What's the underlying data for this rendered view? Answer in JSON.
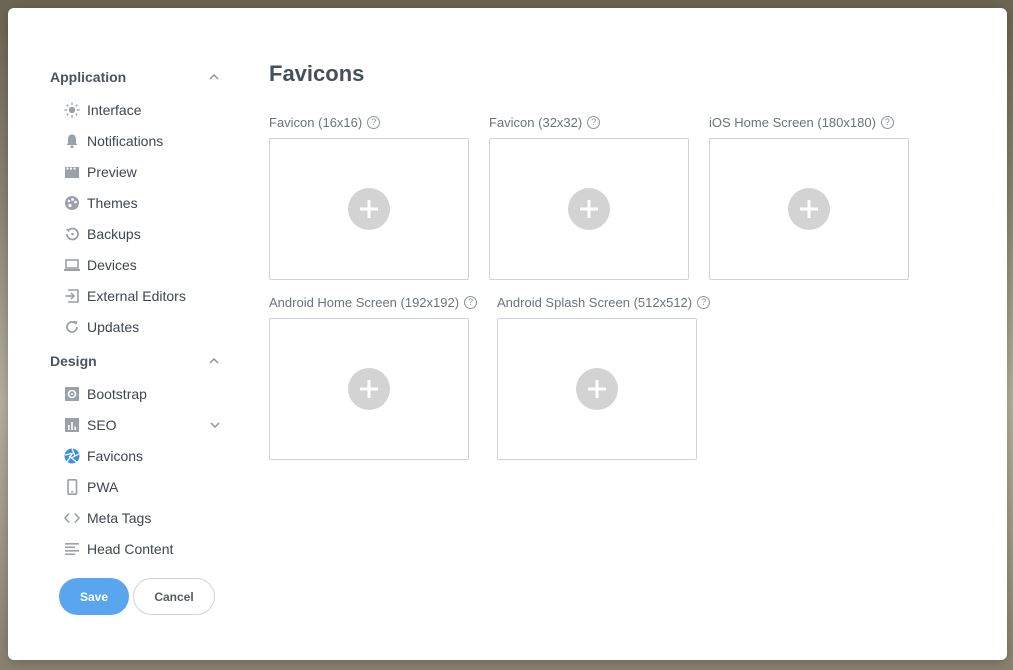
{
  "sidebar": {
    "application": {
      "title": "Application",
      "items": [
        {
          "label": "Interface",
          "icon": "sun-icon"
        },
        {
          "label": "Notifications",
          "icon": "bell-icon"
        },
        {
          "label": "Preview",
          "icon": "clapper-icon"
        },
        {
          "label": "Themes",
          "icon": "palette-icon"
        },
        {
          "label": "Backups",
          "icon": "restore-icon"
        },
        {
          "label": "Devices",
          "icon": "laptop-icon"
        },
        {
          "label": "External Editors",
          "icon": "sign-in-icon"
        },
        {
          "label": "Updates",
          "icon": "refresh-icon"
        }
      ]
    },
    "design": {
      "title": "Design",
      "items": [
        {
          "label": "Bootstrap",
          "icon": "gear-box-icon"
        },
        {
          "label": "SEO",
          "icon": "chart-icon"
        },
        {
          "label": "Favicons",
          "icon": "aperture-icon",
          "active": true
        },
        {
          "label": "PWA",
          "icon": "phone-icon"
        },
        {
          "label": "Meta Tags",
          "icon": "code-icon"
        },
        {
          "label": "Head Content",
          "icon": "align-left-icon"
        }
      ]
    }
  },
  "buttons": {
    "save": "Save",
    "cancel": "Cancel"
  },
  "main": {
    "title": "Favicons",
    "fields": [
      {
        "label": "Favicon (16x16)"
      },
      {
        "label": "Favicon (32x32)"
      },
      {
        "label": "iOS Home Screen (180x180)"
      },
      {
        "label": "Android Home Screen (192x192)"
      },
      {
        "label": "Android Splash Screen (512x512)"
      }
    ],
    "help_glyph": "?"
  },
  "colors": {
    "accent": "#5aa6ee",
    "active_icon": "#3d8fe0",
    "icon": "#9aa1a8"
  }
}
